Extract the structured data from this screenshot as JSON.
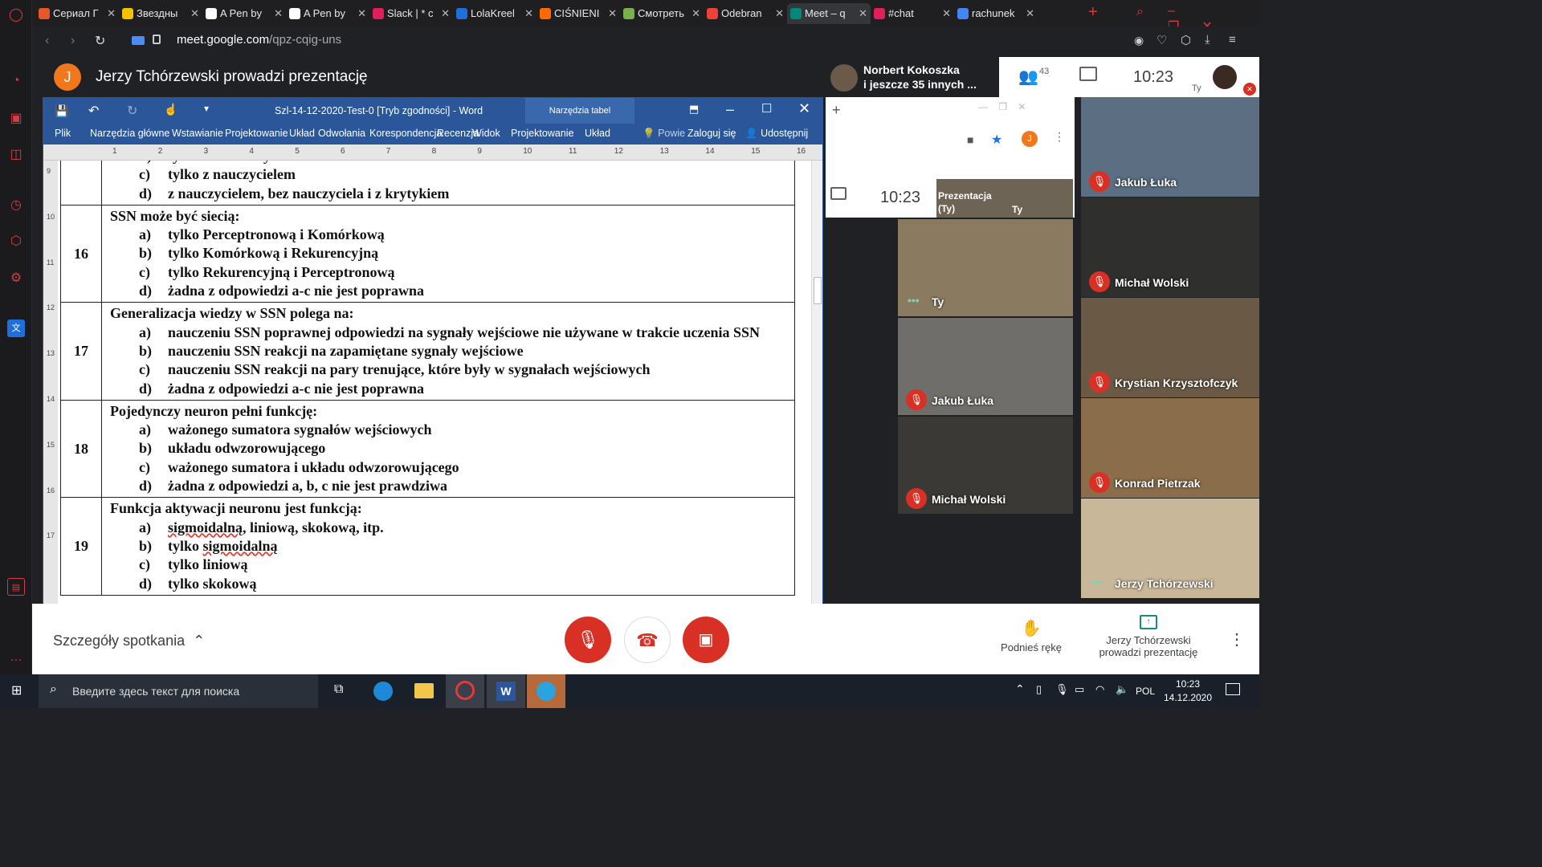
{
  "browser": {
    "tabs": [
      {
        "label": "Сериал Г",
        "color": "#e8572a"
      },
      {
        "label": "Звездны",
        "color": "#f3c300"
      },
      {
        "label": "A Pen by",
        "color": "#ffffff"
      },
      {
        "label": "A Pen by",
        "color": "#ffffff"
      },
      {
        "label": "Slack | * c",
        "color": "#e01e5a"
      },
      {
        "label": "LolaKreel",
        "color": "#1e6fd9"
      },
      {
        "label": "CIŚNIENI",
        "color": "#ff6a00"
      },
      {
        "label": "Смотреть",
        "color": "#7ab04a"
      },
      {
        "label": "Odebran",
        "color": "#ea4335"
      },
      {
        "label": "Meet – q",
        "color": "#00897b"
      },
      {
        "label": "#chat",
        "color": "#e01e5a"
      },
      {
        "label": "rachunek",
        "color": "#4285f4"
      }
    ],
    "url_host": "meet.google.com",
    "url_path": "/qpz-cqig-uns"
  },
  "meet": {
    "presenter_initial": "J",
    "presenter_title": "Jerzy Tchórzewski prowadzi prezentację",
    "participant_name": "Norbert Kokoszka",
    "participant_more": "i jeszcze 35 innych ...",
    "people_count": "43",
    "clock": "10:23",
    "self_label": "Ty",
    "mini_clock": "10:23",
    "mini_presentation": "Prezentacja",
    "mini_presentation_sub": "(Ty)",
    "mini_self": "Ty",
    "details_label": "Szczegóły spotkania",
    "raise_hand": "Podnieś rękę",
    "presenting_line1": "Jerzy Tchórzewski",
    "presenting_line2": "prowadzi prezentację",
    "accent": "#d93025"
  },
  "word": {
    "title": "Szl-14-12-2020-Test-0 [Tryb zgodności] - Word",
    "table_tools": "Narzędzia tabel",
    "ribbon": [
      "Plik",
      "Narzędzia główne",
      "Wstawianie",
      "Projektowanie",
      "Układ",
      "Odwołania",
      "Korespondencja",
      "Recenzja",
      "Widok",
      "Projektowanie",
      "Układ"
    ],
    "tell_me": "Powie",
    "sign_in": "Zaloguj się",
    "share": "Udostępnij",
    "ruler_marks": [
      "1",
      "2",
      "3",
      "4",
      "5",
      "6",
      "7",
      "8",
      "9",
      "10",
      "11",
      "12",
      "13",
      "14",
      "15",
      "16"
    ],
    "vruler_marks": [
      "9",
      "10",
      "11",
      "12",
      "13",
      "14",
      "15",
      "16",
      "17"
    ],
    "questions": [
      {
        "num": "",
        "question": "",
        "options": [
          {
            "letter": "b)",
            "text": "tylko bez nauczyciela"
          },
          {
            "letter": "c)",
            "text": "tylko z nauczycielem"
          },
          {
            "letter": "d)",
            "text": "z nauczycielem, bez nauczyciela i z krytykiem"
          }
        ]
      },
      {
        "num": "16",
        "question": "SSN może być siecią:",
        "options": [
          {
            "letter": "a)",
            "text": "tylko Perceptronową i Komórkową"
          },
          {
            "letter": "b)",
            "text": "tylko Komórkową i Rekurencyjną"
          },
          {
            "letter": "c)",
            "text": "tylko Rekurencyjną i Perceptronową"
          },
          {
            "letter": "d)",
            "text": "żadna z odpowiedzi a-c nie jest poprawna"
          }
        ]
      },
      {
        "num": "17",
        "question": "Generalizacja wiedzy w SSN polega na:",
        "options": [
          {
            "letter": "a)",
            "text": "nauczeniu SSN poprawnej odpowiedzi na sygnały wejściowe nie używane w trakcie uczenia SSN"
          },
          {
            "letter": "b)",
            "text": "nauczeniu SSN reakcji na zapamiętane sygnały wejściowe"
          },
          {
            "letter": "c)",
            "text": "nauczeniu SSN reakcji na pary trenujące, które były w sygnałach wejściowych"
          },
          {
            "letter": "d)",
            "text": "żadna z odpowiedzi a-c nie jest poprawna"
          }
        ]
      },
      {
        "num": "18",
        "question": "Pojedynczy neuron pełni funkcję:",
        "options": [
          {
            "letter": "a)",
            "text": "ważonego sumatora sygnałów wejściowych"
          },
          {
            "letter": "b)",
            "text": "układu odwzorowującego"
          },
          {
            "letter": "c)",
            "text": "ważonego sumatora i układu odwzorowującego"
          },
          {
            "letter": "d)",
            "text": "żadna z odpowiedzi a, b, c nie jest prawdziwa"
          }
        ]
      },
      {
        "num": "19",
        "question": "Funkcja aktywacji neuronu jest funkcją:",
        "options": [
          {
            "letter": "a)",
            "text": "sigmoidalną, liniową, skokową, itp."
          },
          {
            "letter": "b)",
            "text": "tylko sigmoidalną"
          },
          {
            "letter": "c)",
            "text": "tylko liniową"
          },
          {
            "letter": "d)",
            "text": "tylko skokową"
          }
        ]
      }
    ]
  },
  "participants": [
    {
      "name": "Jakub Łuka",
      "muted": true
    },
    {
      "name": "Michał Wolski",
      "muted": true
    },
    {
      "name": "Krystian Krzysztofczyk",
      "muted": true
    },
    {
      "name": "Konrad Pietrzak",
      "muted": true
    },
    {
      "name": "Jerzy Tchórzewski",
      "muted": false
    }
  ],
  "inner_tiles": [
    {
      "name": "Ty",
      "muted": false
    },
    {
      "name": "Jakub Łuka",
      "muted": true
    },
    {
      "name": "Michał Wolski",
      "muted": true
    }
  ],
  "taskbar": {
    "search_placeholder": "Введите здесь текст для поиска",
    "lang": "POL",
    "time": "10:23",
    "date": "14.12.2020"
  }
}
